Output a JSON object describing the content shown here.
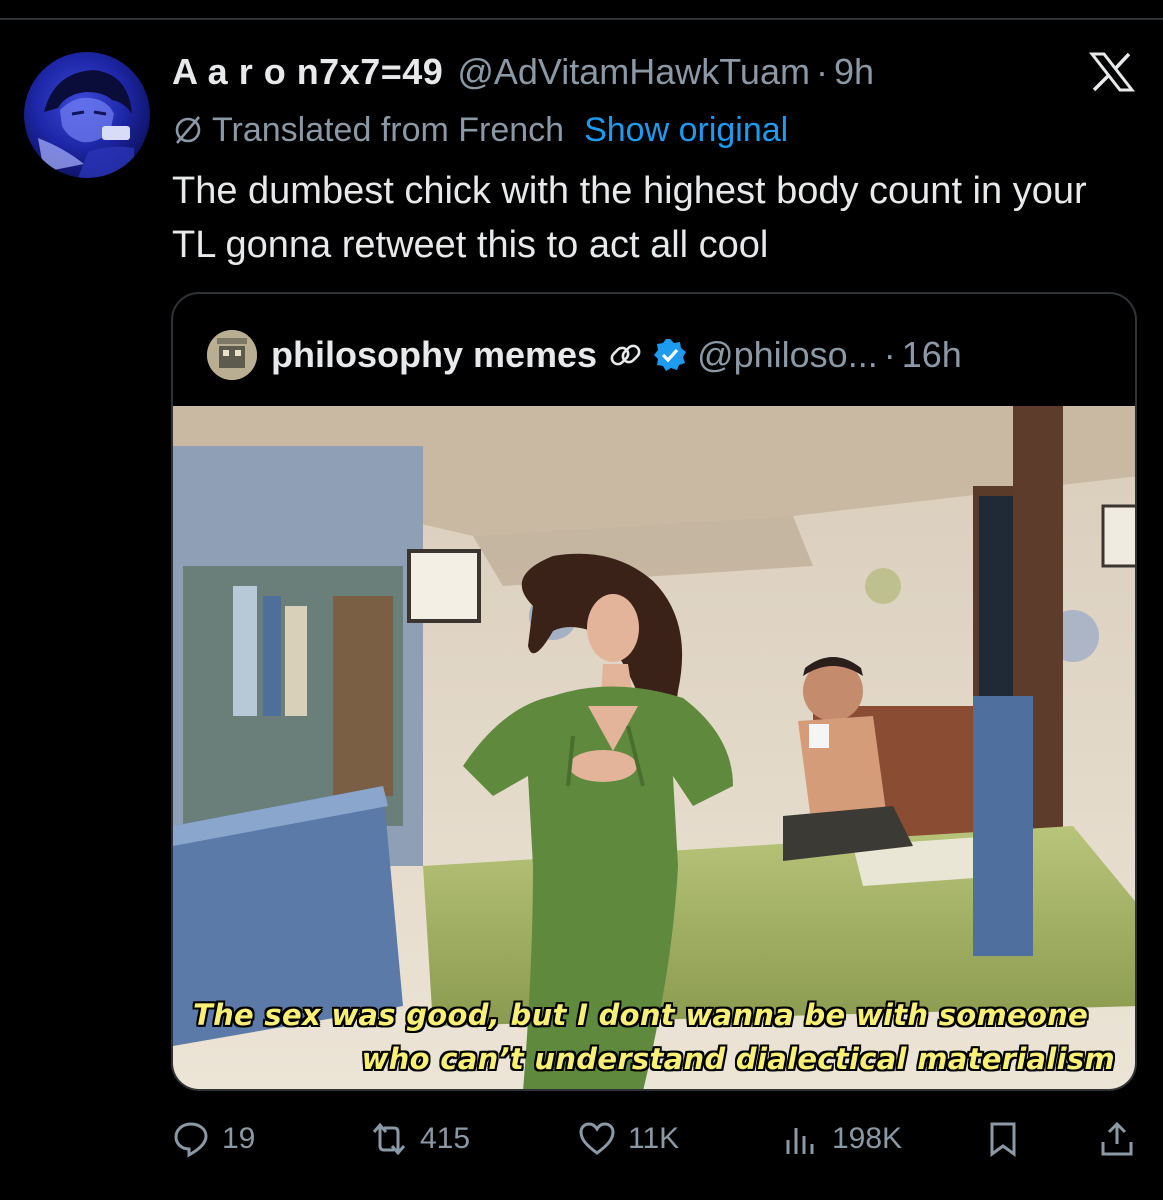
{
  "tweet": {
    "display_name": "A a r o n7x7=49",
    "handle": "@AdVitamHawkTuam",
    "separator": "·",
    "time": "9h",
    "translated_label": "Translated from French",
    "show_original_label": "Show original",
    "text": "The dumbest chick with the highest body count in your TL gonna retweet this to act all cool"
  },
  "quote": {
    "name": "philosophy memes",
    "handle": "@philoso...",
    "separator": "·",
    "time": "16h",
    "caption_line1": "The sex was good, but I dont wanna be with someone",
    "caption_line2": "who can’t understand dialectical materialism"
  },
  "actions": {
    "replies": "19",
    "retweets": "415",
    "likes": "11K",
    "views": "198K"
  },
  "icons": {
    "platform_logo": "x-logo-icon",
    "translate": "globe-slash-icon",
    "link": "link-icon",
    "verified": "verified-badge-icon",
    "reply": "reply-icon",
    "retweet": "retweet-icon",
    "like": "heart-icon",
    "views": "views-icon",
    "bookmark": "bookmark-icon",
    "share": "share-icon"
  },
  "colors": {
    "background": "#000000",
    "primary_text": "#e7e9ea",
    "secondary_text": "#8b98a5",
    "accent": "#1d9bf0",
    "border": "#2f3336",
    "caption": "#f7ef76"
  }
}
